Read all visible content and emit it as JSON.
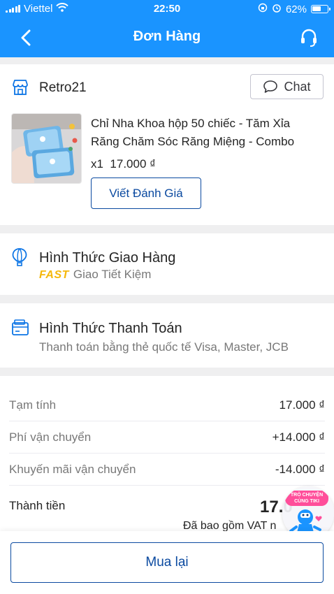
{
  "status_bar": {
    "carrier": "Viettel",
    "time": "22:50",
    "battery": "62%",
    "battery_level": 0.62
  },
  "header": {
    "title": "Đơn Hàng"
  },
  "shop": {
    "name": "Retro21",
    "chat_label": "Chat"
  },
  "product": {
    "name": "Chỉ Nha Khoa hộp 50 chiếc - Tăm Xỉa Răng Chăm Sóc Răng Miệng - Combo",
    "qty": "x1",
    "price": "17.000 ₫",
    "review_label": "Viết Đánh Giá"
  },
  "shipping": {
    "title": "Hình Thức Giao Hàng",
    "badge": "FAST",
    "method": "Giao Tiết Kiệm"
  },
  "payment": {
    "title": "Hình Thức Thanh Toán",
    "method": "Thanh toán bằng thẻ quốc tế Visa, Master, JCB"
  },
  "summary": {
    "rows": [
      {
        "label": "Tạm tính",
        "value": "17.000 ₫"
      },
      {
        "label": "Phí vận chuyển",
        "value": "+14.000 ₫"
      },
      {
        "label": "Khuyến mãi vận chuyển",
        "value": "-14.000 ₫"
      }
    ],
    "total_label": "Thành tiền",
    "total_value": "17.0",
    "vat_note": "Đã bao gồm VAT n"
  },
  "chat_bubble": {
    "tag_line1": "TRÒ CHUYỆN",
    "tag_line2": "CÙNG TIKI"
  },
  "footer": {
    "rebuy_label": "Mua lại"
  },
  "colors": {
    "primary": "#1a94ff",
    "link": "#0b4aa0",
    "fast": "#f5b80b"
  }
}
